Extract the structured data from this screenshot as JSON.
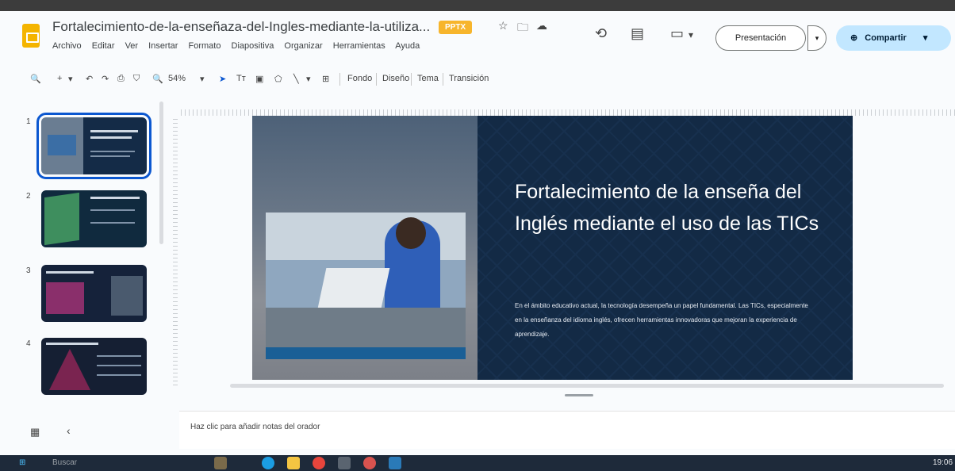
{
  "header": {
    "doc_title": "Fortalecimiento-de-la-enseñaza-del-Ingles-mediante-la-utiliza...",
    "badge": "PPTX",
    "menu": [
      "Archivo",
      "Editar",
      "Ver",
      "Insertar",
      "Formato",
      "Diapositiva",
      "Organizar",
      "Herramientas",
      "Ayuda"
    ],
    "present_label": "Presentación",
    "share_label": "Compartir",
    "star_glyph": "☆",
    "folder_glyph": "🗀",
    "cloud_glyph": "☁",
    "history_glyph": "⟲",
    "comments_glyph": "▤",
    "meet_glyph": "▭",
    "dropdown_glyph": "▾",
    "share_glyph": "⊕"
  },
  "toolbar": {
    "search_glyph": "🔍",
    "new_glyph": "+",
    "undo_glyph": "↶",
    "redo_glyph": "↷",
    "print_glyph": "⎙",
    "paint_glyph": "⛉",
    "zoom_glyph": "🔍",
    "zoom": "54%",
    "select_glyph": "➤",
    "textbox_glyph": "Tт",
    "image_glyph": "▣",
    "shape_glyph": "⬠",
    "line_glyph": "╲",
    "comment_add_glyph": "⊞",
    "items": [
      "Fondo",
      "Diseño",
      "Tema",
      "Transición"
    ]
  },
  "filmstrip": {
    "slides": [
      "1",
      "2",
      "3",
      "4"
    ]
  },
  "slide": {
    "title": "Fortalecimiento de la enseña del Inglés mediante el uso de las TICs",
    "body": "En el ámbito educativo actual, la tecnología desempeña un papel fundamental. Las TICs, especialmente en la enseñanza del idioma inglés, ofrecen herramientas innovadoras que mejoran la experiencia de aprendizaje."
  },
  "notes": {
    "placeholder": "Haz clic para añadir notas del orador"
  },
  "bottom": {
    "grid_glyph": "▦",
    "collapse_glyph": "‹"
  },
  "taskbar": {
    "start_glyph": "⊞",
    "search_text": "Buscar",
    "time": "19:06"
  },
  "colors": {
    "accent": "#0b57d0",
    "share_bg": "#c2e7ff",
    "slide_bg": "#132a45"
  }
}
